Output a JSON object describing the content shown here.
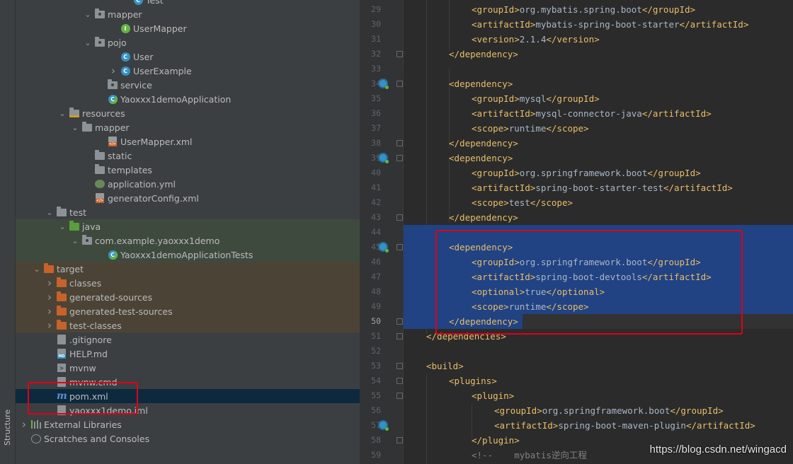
{
  "strip": {
    "label": "Structure"
  },
  "tree": [
    {
      "label": "Test",
      "icon": "class-icon",
      "depth": 8
    },
    {
      "label": "mapper",
      "icon": "package-icon",
      "depth": 5,
      "arrow": "down"
    },
    {
      "label": "UserMapper",
      "icon": "interface-icon",
      "depth": 7
    },
    {
      "label": "pojo",
      "icon": "package-icon",
      "depth": 5,
      "arrow": "down"
    },
    {
      "label": "User",
      "icon": "class-icon",
      "depth": 7
    },
    {
      "label": "UserExample",
      "icon": "class-icon",
      "depth": 7,
      "arrow": "right"
    },
    {
      "label": "service",
      "icon": "package-icon",
      "depth": 6
    },
    {
      "label": "Yaoxxx1demoApplication",
      "icon": "spring-class-icon",
      "depth": 6
    },
    {
      "label": "resources",
      "icon": "resources-folder-icon",
      "depth": 3,
      "arrow": "down"
    },
    {
      "label": "mapper",
      "icon": "folder-icon",
      "depth": 4,
      "arrow": "down"
    },
    {
      "label": "UserMapper.xml",
      "icon": "xml-file-icon",
      "depth": 6
    },
    {
      "label": "static",
      "icon": "folder-icon",
      "depth": 5
    },
    {
      "label": "templates",
      "icon": "folder-icon",
      "depth": 5
    },
    {
      "label": "application.yml",
      "icon": "yml-file-icon",
      "depth": 5
    },
    {
      "label": "generatorConfig.xml",
      "icon": "xml-file-icon",
      "depth": 5
    },
    {
      "label": "test",
      "icon": "folder-icon",
      "depth": 2,
      "arrow": "down"
    },
    {
      "label": "java",
      "icon": "test-folder-icon",
      "depth": 3,
      "arrow": "down",
      "bg": "green"
    },
    {
      "label": "com.example.yaoxxx1demo",
      "icon": "package-icon",
      "depth": 4,
      "arrow": "down",
      "bg": "green"
    },
    {
      "label": "Yaoxxx1demoApplicationTests",
      "icon": "spring-class-icon",
      "depth": 6,
      "bg": "green"
    },
    {
      "label": "target",
      "icon": "excluded-folder-icon",
      "depth": 1,
      "arrow": "down",
      "bg": "orange"
    },
    {
      "label": "classes",
      "icon": "excluded-folder-icon",
      "depth": 2,
      "arrow": "right",
      "bg": "orange"
    },
    {
      "label": "generated-sources",
      "icon": "excluded-folder-icon",
      "depth": 2,
      "arrow": "right",
      "bg": "orange"
    },
    {
      "label": "generated-test-sources",
      "icon": "excluded-folder-icon",
      "depth": 2,
      "arrow": "right",
      "bg": "orange"
    },
    {
      "label": "test-classes",
      "icon": "excluded-folder-icon",
      "depth": 2,
      "arrow": "right",
      "bg": "orange"
    },
    {
      "label": ".gitignore",
      "icon": "file-icon",
      "depth": 2
    },
    {
      "label": "HELP.md",
      "icon": "md-file-icon",
      "depth": 2
    },
    {
      "label": "mvnw",
      "icon": "terminal-file-icon",
      "depth": 2
    },
    {
      "label": "mvnw.cmd",
      "icon": "file-icon",
      "depth": 2
    },
    {
      "label": "pom.xml",
      "icon": "maven-icon",
      "depth": 2,
      "bg": "selected"
    },
    {
      "label": "yaoxxx1demo.iml",
      "icon": "module-file-icon",
      "depth": 2
    },
    {
      "label": "External Libraries",
      "icon": "libraries-icon",
      "depth": 0,
      "arrow": "right"
    },
    {
      "label": "Scratches and Consoles",
      "icon": "scratches-icon",
      "depth": 0
    }
  ],
  "editor": {
    "current_line": "50",
    "lines": [
      {
        "n": "29",
        "indent": 3,
        "parts": [
          [
            "tag",
            "<groupId>"
          ],
          [
            "txt",
            "org.mybatis.spring.boot"
          ],
          [
            "tag",
            "</groupId>"
          ]
        ]
      },
      {
        "n": "30",
        "indent": 3,
        "parts": [
          [
            "tag",
            "<artifactId>"
          ],
          [
            "txt",
            "mybatis-spring-boot-starter"
          ],
          [
            "tag",
            "</artifactId>"
          ]
        ]
      },
      {
        "n": "31",
        "indent": 3,
        "parts": [
          [
            "tag",
            "<version>"
          ],
          [
            "txt",
            "2.1.4"
          ],
          [
            "tag",
            "</version>"
          ]
        ]
      },
      {
        "n": "32",
        "indent": 2,
        "parts": [
          [
            "tag",
            "</dependency>"
          ]
        ],
        "fold": true
      },
      {
        "n": "33",
        "indent": 0,
        "parts": []
      },
      {
        "n": "34",
        "indent": 2,
        "parts": [
          [
            "tag",
            "<dependency>"
          ]
        ],
        "fold": true,
        "gicon": true
      },
      {
        "n": "35",
        "indent": 3,
        "parts": [
          [
            "tag",
            "<groupId>"
          ],
          [
            "txt",
            "mysql"
          ],
          [
            "tag",
            "</groupId>"
          ]
        ]
      },
      {
        "n": "36",
        "indent": 3,
        "parts": [
          [
            "tag",
            "<artifactId>"
          ],
          [
            "txt",
            "mysql-connector-java"
          ],
          [
            "tag",
            "</artifactId>"
          ]
        ]
      },
      {
        "n": "37",
        "indent": 3,
        "parts": [
          [
            "tag",
            "<scope>"
          ],
          [
            "txt",
            "runtime"
          ],
          [
            "tag",
            "</scope>"
          ]
        ]
      },
      {
        "n": "38",
        "indent": 2,
        "parts": [
          [
            "tag",
            "</dependency>"
          ]
        ],
        "fold": true
      },
      {
        "n": "39",
        "indent": 2,
        "parts": [
          [
            "tag",
            "<dependency>"
          ]
        ],
        "fold": true,
        "gicon": true
      },
      {
        "n": "40",
        "indent": 3,
        "parts": [
          [
            "tag",
            "<groupId>"
          ],
          [
            "txt",
            "org.springframework.boot"
          ],
          [
            "tag",
            "</groupId>"
          ]
        ]
      },
      {
        "n": "41",
        "indent": 3,
        "parts": [
          [
            "tag",
            "<artifactId>"
          ],
          [
            "txt",
            "spring-boot-starter-test"
          ],
          [
            "tag",
            "</artifactId>"
          ]
        ]
      },
      {
        "n": "42",
        "indent": 3,
        "parts": [
          [
            "tag",
            "<scope>"
          ],
          [
            "txt",
            "test"
          ],
          [
            "tag",
            "</scope>"
          ]
        ]
      },
      {
        "n": "43",
        "indent": 2,
        "parts": [
          [
            "tag",
            "</dependency>"
          ]
        ],
        "fold": true
      },
      {
        "n": "44",
        "indent": 0,
        "parts": []
      },
      {
        "n": "45",
        "indent": 2,
        "parts": [
          [
            "tag",
            "<dependency>"
          ]
        ],
        "fold": true,
        "gicon": true
      },
      {
        "n": "46",
        "indent": 3,
        "parts": [
          [
            "tag",
            "<groupId>"
          ],
          [
            "txt",
            "org.springframework.boot"
          ],
          [
            "tag",
            "</groupId>"
          ]
        ]
      },
      {
        "n": "47",
        "indent": 3,
        "parts": [
          [
            "tag",
            "<artifactId>"
          ],
          [
            "txt",
            "spring-boot-devtools"
          ],
          [
            "tag",
            "</artifactId>"
          ]
        ]
      },
      {
        "n": "48",
        "indent": 3,
        "parts": [
          [
            "tag",
            "<optional>"
          ],
          [
            "txt",
            "true"
          ],
          [
            "tag",
            "</optional>"
          ]
        ]
      },
      {
        "n": "49",
        "indent": 3,
        "parts": [
          [
            "tag",
            "<scope>"
          ],
          [
            "txt",
            "runtime"
          ],
          [
            "tag",
            "</scope>"
          ]
        ]
      },
      {
        "n": "50",
        "indent": 2,
        "parts": [
          [
            "tag",
            "</dependency>"
          ]
        ],
        "fold": true
      },
      {
        "n": "51",
        "indent": 1,
        "parts": [
          [
            "tag",
            "</dependencies>"
          ]
        ],
        "fold": true
      },
      {
        "n": "52",
        "indent": 0,
        "parts": []
      },
      {
        "n": "53",
        "indent": 1,
        "parts": [
          [
            "tag",
            "<build>"
          ]
        ],
        "fold": true
      },
      {
        "n": "54",
        "indent": 2,
        "parts": [
          [
            "tag",
            "<plugins>"
          ]
        ],
        "fold": true
      },
      {
        "n": "55",
        "indent": 3,
        "parts": [
          [
            "tag",
            "<plugin>"
          ]
        ],
        "fold": true
      },
      {
        "n": "56",
        "indent": 4,
        "parts": [
          [
            "tag",
            "<groupId>"
          ],
          [
            "txt",
            "org.springframework.boot"
          ],
          [
            "tag",
            "</groupId>"
          ]
        ]
      },
      {
        "n": "57",
        "indent": 4,
        "parts": [
          [
            "tag",
            "<artifactId>"
          ],
          [
            "txt",
            "spring-boot-maven-plugin"
          ],
          [
            "tag",
            "</artifactId>"
          ]
        ],
        "gicon": true
      },
      {
        "n": "58",
        "indent": 3,
        "parts": [
          [
            "tag",
            "</plugin>"
          ]
        ],
        "fold": true
      },
      {
        "n": "59",
        "indent": 3,
        "parts": [
          [
            "cmt",
            "<!--    mybatis逆向工程"
          ]
        ]
      }
    ]
  },
  "watermark": "https://blog.csdn.net/wingacd",
  "colors": {
    "tag": "#e8bf6a",
    "text": "#a9b7c6",
    "selection": "#214283",
    "highlight_box": "#e0001b"
  }
}
